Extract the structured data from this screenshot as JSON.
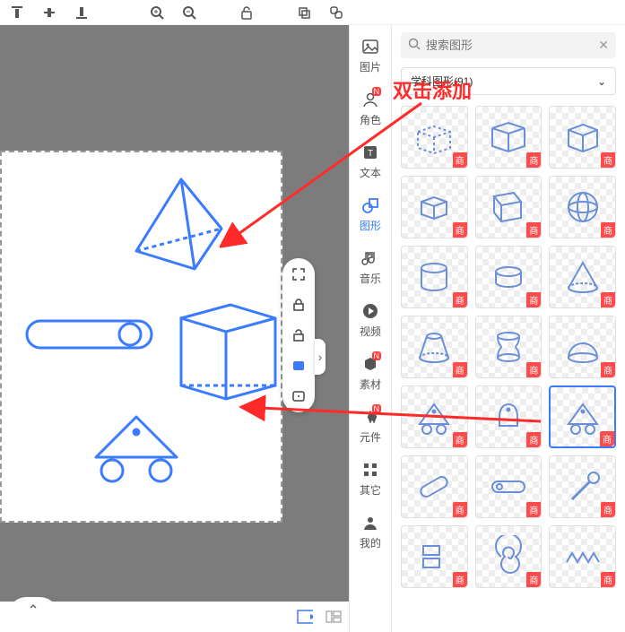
{
  "toolbar": {
    "icons": [
      "align-top",
      "align-middle",
      "align-bottom",
      "zoom-in",
      "zoom-out",
      "unlock",
      "copy",
      "copy-group"
    ]
  },
  "float_tools": [
    "fullscreen",
    "lock-shape",
    "rotate",
    "layer-fill",
    "text-tool"
  ],
  "categories": [
    {
      "key": "image",
      "label": "图片",
      "badge": null,
      "active": false
    },
    {
      "key": "role",
      "label": "角色",
      "badge": "N",
      "active": false
    },
    {
      "key": "text",
      "label": "文本",
      "badge": null,
      "active": false
    },
    {
      "key": "shape",
      "label": "图形",
      "badge": null,
      "active": true
    },
    {
      "key": "music",
      "label": "音乐",
      "badge": null,
      "active": false
    },
    {
      "key": "video",
      "label": "视频",
      "badge": null,
      "active": false
    },
    {
      "key": "material",
      "label": "素材",
      "badge": "N",
      "active": false
    },
    {
      "key": "component",
      "label": "元件",
      "badge": "N",
      "active": false
    },
    {
      "key": "other",
      "label": "其它",
      "badge": null,
      "active": false
    },
    {
      "key": "mine",
      "label": "我的",
      "badge": null,
      "active": false
    }
  ],
  "search": {
    "placeholder": "搜索图形"
  },
  "dropdown": {
    "label": "学科图形(91)"
  },
  "annotation": {
    "text": "双击添加"
  },
  "shapes_grid": [
    {
      "name": "cube-dashed",
      "badge": "商"
    },
    {
      "name": "box-open",
      "badge": "商"
    },
    {
      "name": "cube-solid",
      "badge": "商"
    },
    {
      "name": "cube-small",
      "badge": "商"
    },
    {
      "name": "prism-skew",
      "badge": "商"
    },
    {
      "name": "sphere",
      "badge": "商"
    },
    {
      "name": "cylinder",
      "badge": "商"
    },
    {
      "name": "cylinder-short",
      "badge": "商"
    },
    {
      "name": "cone",
      "badge": "商"
    },
    {
      "name": "frustum",
      "badge": "商"
    },
    {
      "name": "hourglass",
      "badge": "商"
    },
    {
      "name": "dome",
      "badge": "商"
    },
    {
      "name": "cart-triangle",
      "badge": "商"
    },
    {
      "name": "bell",
      "badge": "商"
    },
    {
      "name": "cart-triangle-active",
      "badge": "商",
      "selected": true
    },
    {
      "name": "pill-angled",
      "badge": "商"
    },
    {
      "name": "pill",
      "badge": "商"
    },
    {
      "name": "lever",
      "badge": "商"
    },
    {
      "name": "rects-stack",
      "badge": "商"
    },
    {
      "name": "spiral",
      "badge": "商"
    },
    {
      "name": "zigzag",
      "badge": "商"
    }
  ],
  "canvas_shapes": [
    "pyramid",
    "pill-slider",
    "prism",
    "cart-triangle"
  ]
}
